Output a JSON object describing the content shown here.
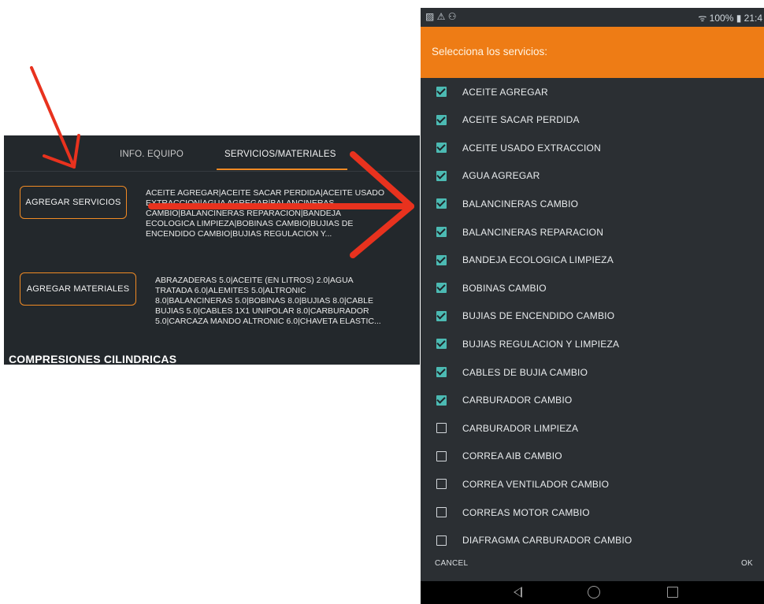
{
  "app_panel": {
    "tabs": [
      {
        "label": "INFO. EQUIPO"
      },
      {
        "label": "SERVICIOS/MATERIALES"
      }
    ],
    "add_services_label": "AGREGAR SERVICIOS",
    "services_summary": "ACEITE AGREGAR|ACEITE SACAR PERDIDA|ACEITE USADO\nEXTRACCION|AGUA AGREGAR|BALANCINERAS\nCAMBIO|BALANCINERAS REPARACION|BANDEJA\nECOLOGICA LIMPIEZA|BOBINAS CAMBIO|BUJIAS DE\nENCENDIDO CAMBIO|BUJIAS REGULACION Y...",
    "add_materials_label": "AGREGAR MATERIALES",
    "materials_summary": "ABRAZADERAS 5.0|ACEITE (EN LITROS) 2.0|AGUA\nTRATADA 6.0|ALEMITES 5.0|ALTRONIC\n8.0|BALANCINERAS 5.0|BOBINAS 8.0|BUJIAS 8.0|CABLE\nBUJIAS 5.0|CABLES 1X1 UNIPOLAR 8.0|CARBURADOR\n5.0|CARCAZA MANDO ALTRONIC 6.0|CHAVETA ELASTIC...",
    "section_title": "COMPRESIONES CILINDRICAS"
  },
  "status_bar": {
    "left_icons": "▨ ⚠ ⚇",
    "right_text": "ᯤ 100% ▮ 21:4"
  },
  "dialog": {
    "title": "Selecciona los servicios:",
    "items": [
      {
        "label": "ACEITE AGREGAR",
        "checked": true
      },
      {
        "label": "ACEITE SACAR PERDIDA",
        "checked": true
      },
      {
        "label": "ACEITE USADO EXTRACCION",
        "checked": true
      },
      {
        "label": "AGUA AGREGAR",
        "checked": true
      },
      {
        "label": "BALANCINERAS CAMBIO",
        "checked": true
      },
      {
        "label": "BALANCINERAS REPARACION",
        "checked": true
      },
      {
        "label": "BANDEJA ECOLOGICA LIMPIEZA",
        "checked": true
      },
      {
        "label": "BOBINAS CAMBIO",
        "checked": true
      },
      {
        "label": "BUJIAS DE ENCENDIDO CAMBIO",
        "checked": true
      },
      {
        "label": "BUJIAS REGULACION Y LIMPIEZA",
        "checked": true
      },
      {
        "label": "CABLES DE BUJIA CAMBIO",
        "checked": true
      },
      {
        "label": "CARBURADOR CAMBIO",
        "checked": true
      },
      {
        "label": "CARBURADOR LIMPIEZA",
        "checked": false
      },
      {
        "label": "CORREA AIB CAMBIO",
        "checked": false
      },
      {
        "label": "CORREA VENTILADOR CAMBIO",
        "checked": false
      },
      {
        "label": "CORREAS MOTOR CAMBIO",
        "checked": false
      },
      {
        "label": "DIAFRAGMA CARBURADOR CAMBIO",
        "checked": false
      }
    ],
    "cancel_label": "CANCEL",
    "ok_label": "OK"
  },
  "colors": {
    "accent": "#ee7c15",
    "checkbox_checked": "#4cbab3",
    "annotation_red": "#e8321e",
    "dark_bg": "#23282c"
  },
  "icons": {
    "nav_back": "back-triangle-icon",
    "nav_home": "home-circle-icon",
    "nav_recent": "recent-square-icon"
  }
}
